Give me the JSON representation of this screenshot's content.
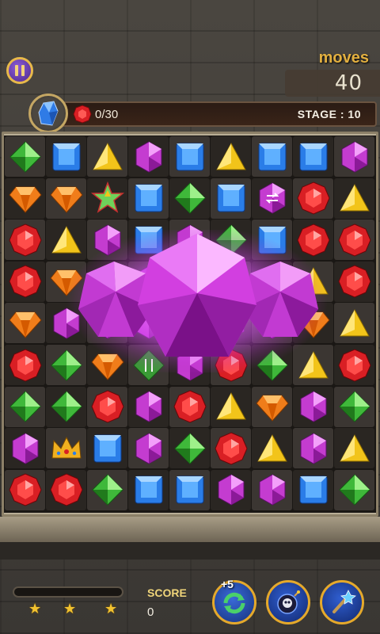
{
  "header": {
    "moves_label": "moves",
    "moves_value": "40",
    "target_count": "0/30",
    "stage": "STAGE : 10"
  },
  "bottom": {
    "score_label": "SCORE",
    "score_value": "0",
    "stars_total": 3,
    "progress": 0,
    "booster_shuffle_badge": "+5"
  },
  "board": {
    "rows": 9,
    "cols": 9,
    "grid": [
      [
        "green",
        "blue",
        "yellow",
        "purple",
        "blue",
        "yellow",
        "blue",
        "blue",
        "purple"
      ],
      [
        "orange",
        "orange",
        "star",
        "blue",
        "green",
        "blue",
        "purple-swap",
        "red",
        "yellow"
      ],
      [
        "red",
        "yellow",
        "purple",
        "blue",
        "purple",
        "green",
        "blue",
        "red",
        "red"
      ],
      [
        "red",
        "orange",
        "purple",
        "purple",
        "purple",
        "purple",
        "purple",
        "yellow",
        "red"
      ],
      [
        "orange",
        "purple",
        "purple",
        "purple",
        "purple",
        "purple",
        "purple",
        "orange",
        "yellow"
      ],
      [
        "red",
        "green",
        "orange",
        "green-swap",
        "purple",
        "red",
        "green",
        "yellow",
        "red"
      ],
      [
        "green",
        "green",
        "red",
        "purple",
        "red",
        "yellow",
        "orange",
        "purple",
        "green"
      ],
      [
        "purple",
        "crown",
        "blue",
        "purple",
        "green",
        "red",
        "yellow",
        "purple",
        "yellow"
      ],
      [
        "red",
        "red",
        "green",
        "blue",
        "blue",
        "purple",
        "purple",
        "blue",
        "green"
      ]
    ]
  },
  "burst_effect": "purple-gem-match-burst",
  "colors": {
    "accent_gold": "#e3b040",
    "gem_red": "#d91f24",
    "gem_green": "#3fb83a",
    "gem_blue": "#2a7de8",
    "gem_yellow": "#f2c41a",
    "gem_purple": "#c43cd0",
    "gem_orange": "#f07d1a"
  }
}
